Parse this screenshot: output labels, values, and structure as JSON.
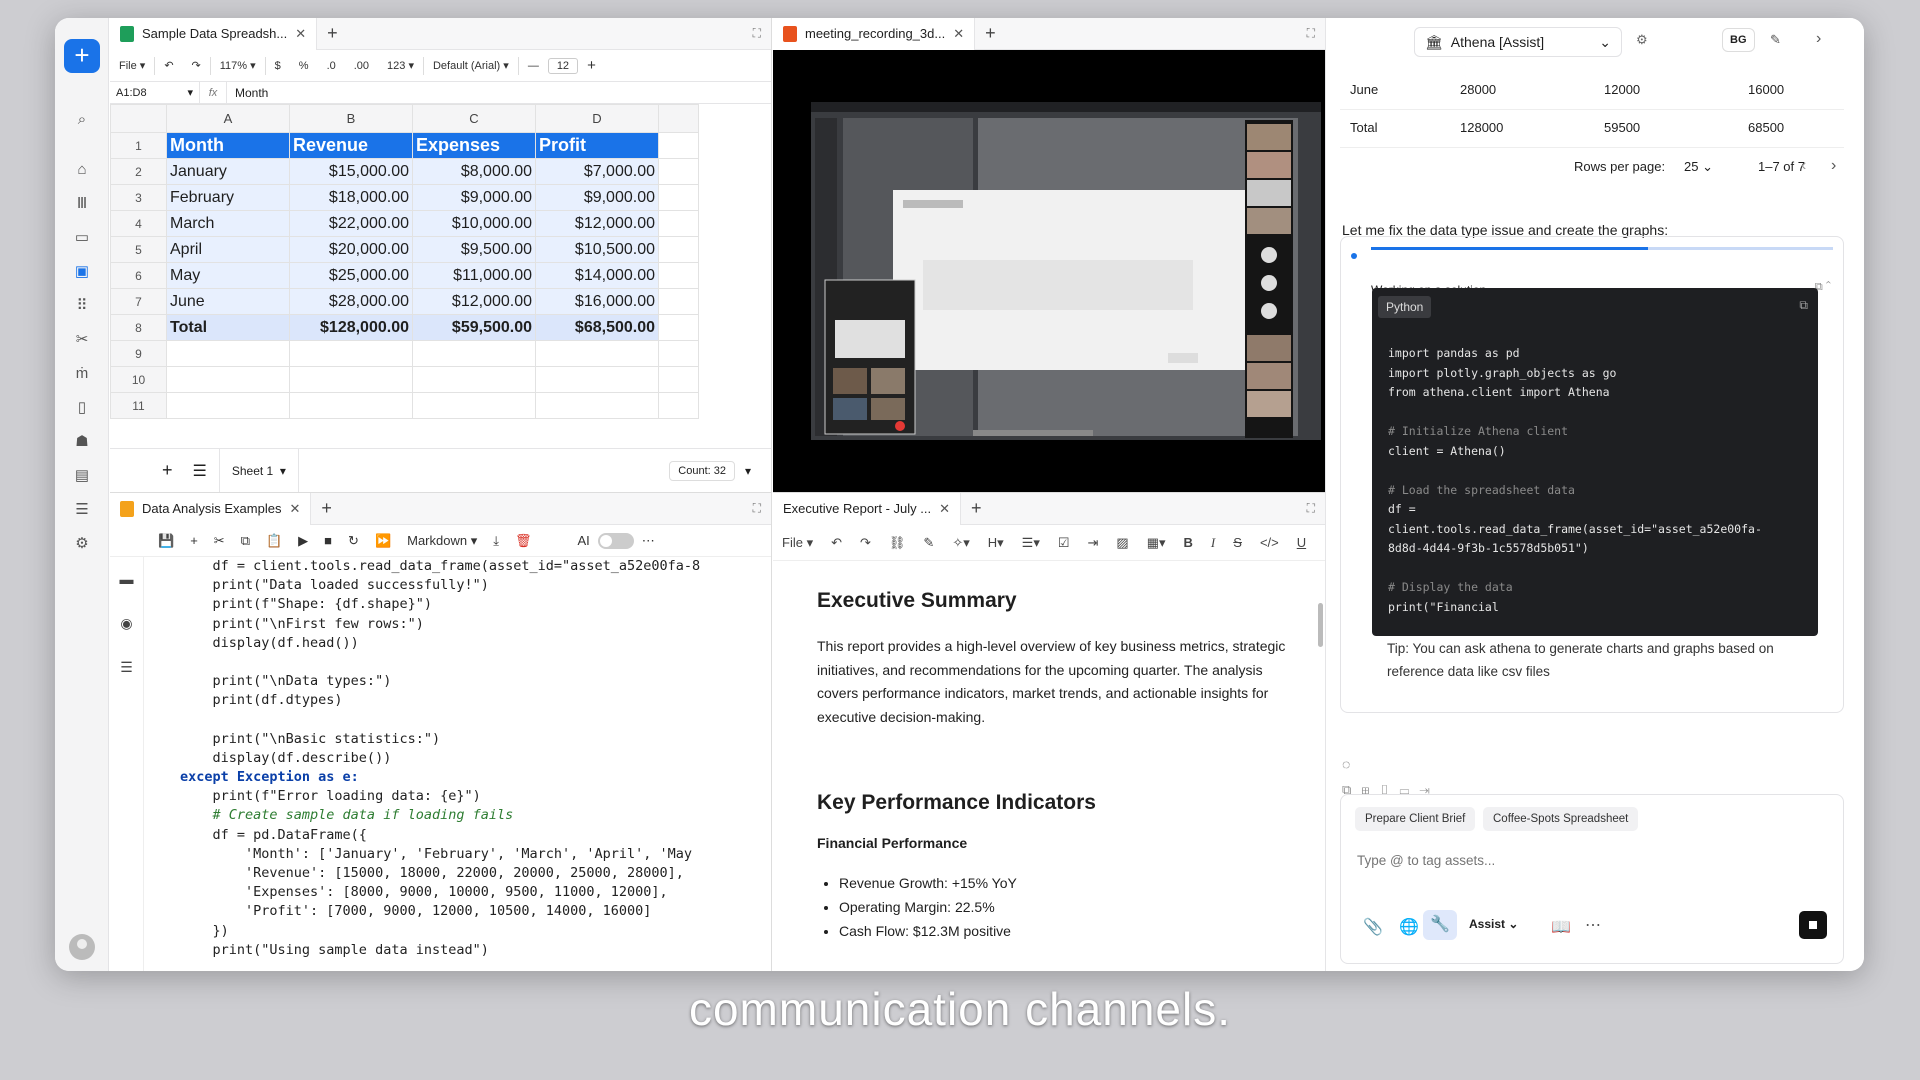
{
  "rail": {
    "icons": [
      "plus-icon",
      "search-icon",
      "home-icon",
      "library-icon",
      "inbox-icon",
      "dashboard-icon",
      "apps-icon",
      "tools-icon",
      "people-icon",
      "book-icon",
      "contacts-icon",
      "document-icon",
      "list-icon",
      "settings-icon"
    ]
  },
  "spreadsheet": {
    "tab_title": "Sample Data Spreadsh...",
    "toolbar": {
      "file": "File",
      "zoom": "117%",
      "currency": "$",
      "percent": "%",
      "dec_less": ".0",
      "dec_more": ".00",
      "format": "123",
      "font": "Default (Arial)",
      "font_size": "12",
      "minus": "—",
      "plus": "+"
    },
    "cell_ref": "A1:D8",
    "fx": "fx",
    "formula": "Month",
    "columns": [
      "A",
      "B",
      "C",
      "D"
    ],
    "rows": [
      [
        "Month",
        "Revenue",
        "Expenses",
        "Profit"
      ],
      [
        "January",
        "$15,000.00",
        "$8,000.00",
        "$7,000.00"
      ],
      [
        "February",
        "$18,000.00",
        "$9,000.00",
        "$9,000.00"
      ],
      [
        "March",
        "$22,000.00",
        "$10,000.00",
        "$12,000.00"
      ],
      [
        "April",
        "$20,000.00",
        "$9,500.00",
        "$10,500.00"
      ],
      [
        "May",
        "$25,000.00",
        "$11,000.00",
        "$14,000.00"
      ],
      [
        "June",
        "$28,000.00",
        "$12,000.00",
        "$16,000.00"
      ],
      [
        "Total",
        "$128,000.00",
        "$59,500.00",
        "$68,500.00"
      ],
      [
        "",
        "",
        "",
        ""
      ],
      [
        "",
        "",
        "",
        ""
      ],
      [
        "",
        "",
        "",
        ""
      ]
    ],
    "row_numbers": [
      "1",
      "2",
      "3",
      "4",
      "5",
      "6",
      "7",
      "8",
      "9",
      "10",
      "11"
    ],
    "sheet_name": "Sheet 1",
    "count": "Count: 32"
  },
  "video": {
    "tab_title": "meeting_recording_3d..."
  },
  "notebook": {
    "tab_title": "Data Analysis Examples",
    "cell_type": "Markdown",
    "ai_label": "AI",
    "code": [
      "    df = client.tools.read_data_frame(asset_id=\"asset_a52e00fa-8",
      "    print(\"Data loaded successfully!\")",
      "    print(f\"Shape: {df.shape}\")",
      "    print(\"\\nFirst few rows:\")",
      "    display(df.head())",
      "",
      "    print(\"\\nData types:\")",
      "    print(df.dtypes)",
      "",
      "    print(\"\\nBasic statistics:\")",
      "    display(df.describe())",
      "except Exception as e:",
      "    print(f\"Error loading data: {e}\")",
      "    # Create sample data if loading fails",
      "    df = pd.DataFrame({",
      "        'Month': ['January', 'February', 'March', 'April', 'May",
      "        'Revenue': [15000, 18000, 22000, 20000, 25000, 28000],",
      "        'Expenses': [8000, 9000, 10000, 9500, 11000, 12000],",
      "        'Profit': [7000, 9000, 12000, 10500, 14000, 16000]",
      "    })",
      "    print(\"Using sample data instead\")"
    ]
  },
  "report": {
    "tab_title": "Executive Report - July ...",
    "file": "File",
    "h1": "Executive Summary",
    "intro": "This report provides a high-level overview of key business metrics, strategic initiatives, and recommendations for the upcoming quarter. The analysis covers performance indicators, market trends, and actionable insights for executive decision-making.",
    "h2": "Key Performance Indicators",
    "h3": "Financial Performance",
    "bullets": [
      "Revenue Growth: +15% YoY",
      "Operating Margin: 22.5%",
      "Cash Flow: $12.3M positive"
    ]
  },
  "assistant": {
    "mode": "Athena [Assist]",
    "user_initials": "BG",
    "table_rows": [
      [
        "June",
        "28000",
        "12000",
        "16000"
      ],
      [
        "Total",
        "128000",
        "59500",
        "68500"
      ]
    ],
    "rows_per_page_label": "Rows per page:",
    "rows_per_page": "25",
    "range": "1–7 of 7",
    "message": "Let me fix the data type issue and create the graphs:",
    "status": "Working on a solution...",
    "code_lang": "Python",
    "code": [
      "import pandas as pd",
      "import plotly.graph_objects as go",
      "from athena.client import Athena",
      "",
      "# Initialize Athena client",
      "client = Athena()",
      "",
      "# Load the spreadsheet data",
      "df =",
      "client.tools.read_data_frame(asset_id=\"asset_a52e00fa-",
      "8d8d-4d44-9f3b-1c5578d5b051\")",
      "",
      "# Display the data",
      "print(\"Financial"
    ],
    "tip": "Tip: You can ask athena to generate charts and graphs based on reference data like csv files",
    "chips": [
      "Prepare Client Brief",
      "Coffee-Spots Spreadsheet"
    ],
    "input_placeholder": "Type @ to tag assets...",
    "assist_label": "Assist"
  },
  "caption": "communication channels."
}
